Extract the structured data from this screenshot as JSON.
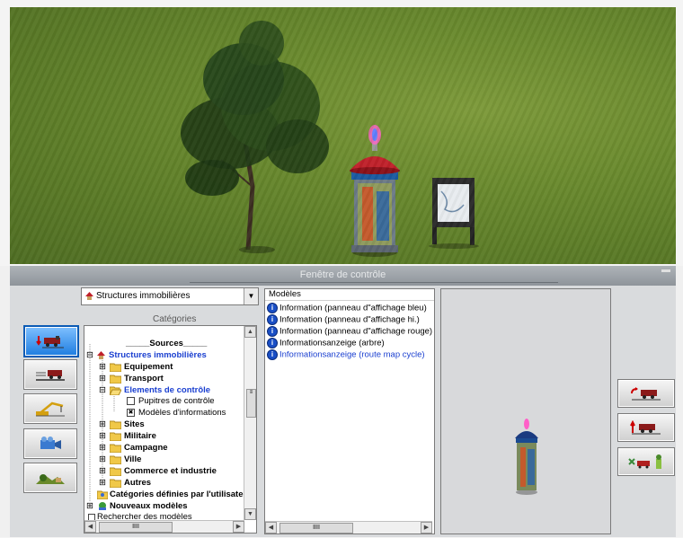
{
  "panel": {
    "title": "Fenêtre de contrôle"
  },
  "combo": {
    "value": "Structures immobilières"
  },
  "categories_label": "Catégories",
  "tree": {
    "items": [
      {
        "label": "_____Sources_____",
        "style": "bold"
      },
      {
        "label": "Structures immobilières",
        "style": "bold-blue"
      },
      {
        "label": "Equipement",
        "style": "bold"
      },
      {
        "label": "Transport",
        "style": "bold"
      },
      {
        "label": "Elements de contrôle",
        "style": "bold-blue"
      },
      {
        "label": "Pupitres de contrôle",
        "style": "normal"
      },
      {
        "label": "Modèles d'informations",
        "style": "normal"
      },
      {
        "label": "Sites",
        "style": "bold"
      },
      {
        "label": "Militaire",
        "style": "bold"
      },
      {
        "label": "Campagne",
        "style": "bold"
      },
      {
        "label": "Ville",
        "style": "bold"
      },
      {
        "label": "Commerce et industrie",
        "style": "bold"
      },
      {
        "label": "Autres",
        "style": "bold"
      },
      {
        "label": "Catégories définies par l'utilisateur",
        "style": "bold"
      },
      {
        "label": "Nouveaux modèles",
        "style": "bold"
      },
      {
        "label": "Rechercher des modèles",
        "style": "normal"
      }
    ]
  },
  "models": {
    "header": "Modèles",
    "items": [
      {
        "label": "Information (panneau d\"affichage bleu)"
      },
      {
        "label": "Information (panneau d\"affichage hi.)"
      },
      {
        "label": "Information (panneau d\"affichage rouge)"
      },
      {
        "label": "Informationsanzeige (arbre)"
      },
      {
        "label": "Informationsanzeige (route map cycle)"
      }
    ]
  },
  "scrollbar": {
    "thumb": "IIII"
  },
  "icons": {
    "left_buttons": [
      "insert-train-icon",
      "track-train-icon",
      "crane-icon",
      "camera-icon",
      "landscape-icon"
    ],
    "right_buttons": [
      "rotate-train-icon",
      "raise-train-icon",
      "move-objects-icon"
    ]
  },
  "colors": {
    "selected_blue": "#1a3fd0",
    "title_bar": "#9aa0a6",
    "active_button": "#1e7de0"
  }
}
